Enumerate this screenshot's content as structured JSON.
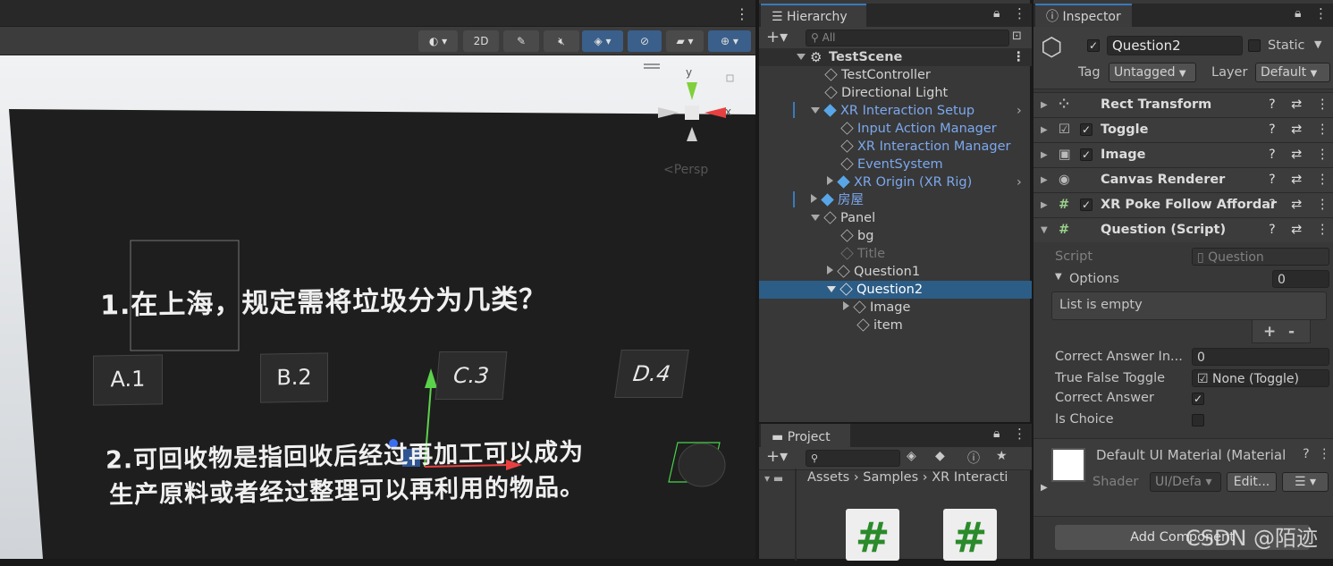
{
  "scene": {
    "toolbar": {
      "btn_2d": "2D"
    },
    "gizmo": {
      "axis_y": "y",
      "axis_x": "x",
      "persp": "<Persp"
    },
    "question1": "1.在上海，规定需将垃圾分为几类？",
    "answers": [
      "A.1",
      "B.2",
      "C.3",
      "D.4"
    ],
    "question2_line1": "2.可回收物是指回收后经过再加工可以成为",
    "question2_line2": "生产原料或者经过整理可以再利用的物品。"
  },
  "hierarchy": {
    "tab": "Hierarchy",
    "search_placeholder": "All",
    "scene_name": "TestScene",
    "items": [
      "TestController",
      "Directional Light",
      "XR Interaction Setup",
      "Input Action Manager",
      "XR Interaction Manager",
      "EventSystem",
      "XR Origin (XR Rig)",
      "房屋",
      "Panel",
      "bg",
      "Title",
      "Question1",
      "Question2",
      "Image",
      "item"
    ]
  },
  "project": {
    "tab": "Project",
    "breadcrumb": [
      "Assets",
      "Samples",
      "XR Interacti"
    ]
  },
  "inspector": {
    "tab": "Inspector",
    "object_name": "Question2",
    "static_label": "Static",
    "tag_label": "Tag",
    "tag_value": "Untagged",
    "layer_label": "Layer",
    "layer_value": "Default",
    "components": [
      "Rect Transform",
      "Toggle",
      "Image",
      "Canvas Renderer",
      "XR Poke Follow Affordar",
      "Question (Script)"
    ],
    "script_label": "Script",
    "script_value": "Question",
    "options_label": "Options",
    "options_count": "0",
    "list_empty": "List is empty",
    "plus": "+",
    "minus": "-",
    "correct_index_label": "Correct Answer In...",
    "correct_index_value": "0",
    "true_false_label": "True False Toggle",
    "true_false_value": "None (Toggle)",
    "correct_answer_label": "Correct Answer",
    "is_choice_label": "Is Choice",
    "material_name": "Default UI Material (Material",
    "shader_label": "Shader",
    "shader_value": "UI/Defa",
    "edit_button": "Edit...",
    "add_component": "Add Component",
    "watermark": "CSDN @陌迹"
  }
}
